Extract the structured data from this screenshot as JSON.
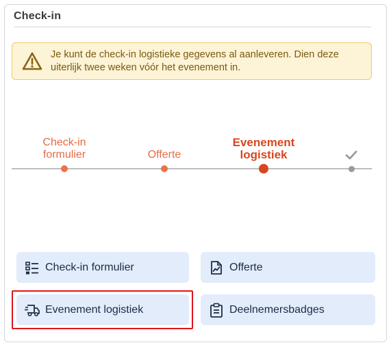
{
  "card": {
    "title": "Check-in"
  },
  "alert": {
    "icon": "warning-triangle-icon",
    "text": "Je kunt de check-in logistieke gegevens al aanleveren. Dien deze uiterlijk twee weken vóór het evenement in."
  },
  "stepper": {
    "steps": [
      {
        "label_line1": "Check-in",
        "label_line2": "formulier",
        "state": "completed"
      },
      {
        "label_line1": "Offerte",
        "label_line2": "",
        "state": "completed"
      },
      {
        "label_line1": "Evenement",
        "label_line2": "logistiek",
        "state": "active"
      },
      {
        "label_line1": "",
        "label_line2": "",
        "state": "pending",
        "icon": "checkmark-icon"
      }
    ]
  },
  "actions": {
    "checkin_form": {
      "label": "Check-in formulier",
      "icon": "checklist-icon"
    },
    "offerte": {
      "label": "Offerte",
      "icon": "document-chart-icon"
    },
    "event_logistics": {
      "label": "Evenement logistiek",
      "icon": "truck-icon",
      "highlighted": true
    },
    "badges": {
      "label": "Deelnemersbadges",
      "icon": "badge-clipboard-icon"
    }
  },
  "colors": {
    "accent": "#d7471f",
    "step_done": "#ef7049",
    "button_bg": "#e2ecfb",
    "alert_bg": "#fdf3d6",
    "highlight": "#e0141b"
  }
}
